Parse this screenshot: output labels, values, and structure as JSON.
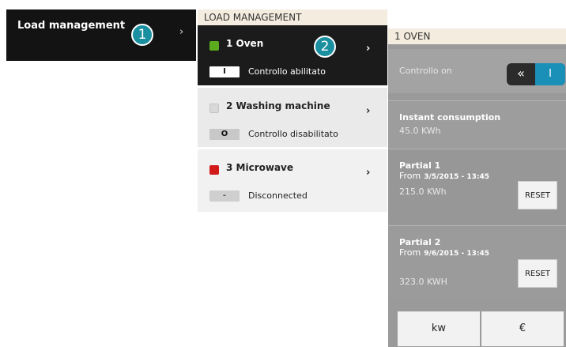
{
  "menu": {
    "label": "Load management",
    "chevron": "›",
    "step_badge": "1"
  },
  "load_management": {
    "header": "LOAD MANAGEMENT",
    "step_badge": "2",
    "loads": [
      {
        "name": "1 Oven",
        "status_color": "#5cab1e",
        "toggle": "I",
        "status": "Controllo abilitato",
        "chevron": "›"
      },
      {
        "name": "2 Washing machine",
        "status_color": "#d8d8d8",
        "toggle": "O",
        "status": "Controllo disabilitato",
        "chevron": "›"
      },
      {
        "name": "3 Microwave",
        "status_color": "#d21a1a",
        "toggle": "-",
        "status": "Disconnected",
        "chevron": "›"
      }
    ]
  },
  "oven_detail": {
    "header": "1 OVEN",
    "control_label": "Controllo on",
    "switch_left": "«",
    "switch_right": "I",
    "instant": {
      "title": "Instant consumption",
      "value": "45.0 KWh"
    },
    "partial1": {
      "title": "Partial 1",
      "from_label": "From",
      "from_date": "3/5/2015 - 13:45",
      "value": "215.0 KWh",
      "reset": "RESET"
    },
    "partial2": {
      "title": "Partial 2",
      "from_label": "From",
      "from_date": "9/6/2015 - 13:45",
      "value": "323.0 KWH",
      "reset": "RESET"
    },
    "units": {
      "kw": "kw",
      "eur": "€"
    }
  },
  "colors": {
    "accent": "#1a8fa0",
    "switch_on": "#1a8fb8",
    "dark_panel": "#131313"
  }
}
